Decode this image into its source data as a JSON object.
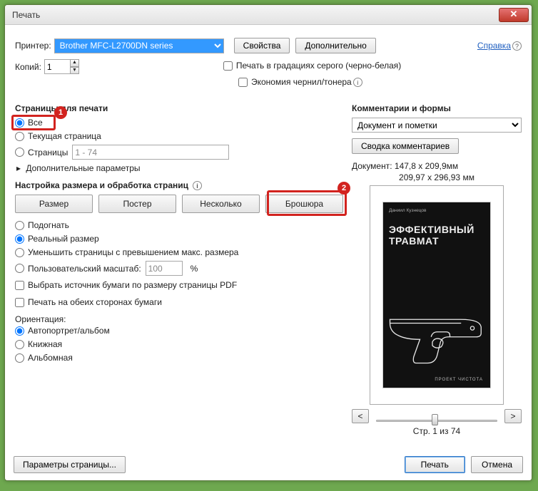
{
  "window_title": "Печать",
  "help_label": "Справка",
  "printer": {
    "label": "Принтер:",
    "selected": "Brother MFC-L2700DN series",
    "properties_btn": "Свойства",
    "advanced_btn": "Дополнительно"
  },
  "copies": {
    "label": "Копий:",
    "value": "1"
  },
  "grayscale": {
    "label": "Печать в градациях серого (черно-белая)",
    "checked": false
  },
  "economy": {
    "label": "Экономия чернил/тонера",
    "checked": false
  },
  "pages": {
    "section": "Страницы для печати",
    "all": "Все",
    "current": "Текущая страница",
    "range_label": "Страницы",
    "range_value": "1 - 74",
    "more": "Дополнительные параметры"
  },
  "sizing": {
    "section": "Настройка размера и обработка страниц",
    "size_btn": "Размер",
    "poster_btn": "Постер",
    "multiple_btn": "Несколько",
    "booklet_btn": "Брошюра",
    "fit": "Подогнать",
    "real": "Реальный размер",
    "shrink": "Уменьшить страницы с превышением макс. размера",
    "custom_label": "Пользовательский масштаб:",
    "custom_value": "100",
    "percent": "%",
    "paper_source": "Выбрать источник бумаги по размеру страницы PDF",
    "duplex": "Печать на обеих сторонах бумаги"
  },
  "orientation": {
    "section": "Ориентация:",
    "auto": "Автопортрет/альбом",
    "portrait": "Книжная",
    "landscape": "Альбомная"
  },
  "comments": {
    "section": "Комментарии и формы",
    "selected": "Документ и пометки",
    "summary_btn": "Сводка комментариев"
  },
  "preview": {
    "doc_size": "Документ: 147,8 x 209,9мм",
    "paper_size": "209,97 x 296,93 мм",
    "author": "Даниил Кузнецов",
    "title1": "ЭФФЕКТИВНЫЙ",
    "title2": "ТРАВМАТ",
    "footer": "ПРОЕКТ ЧИСТОТА",
    "page_indicator": "Стр. 1 из 74",
    "prev": "<",
    "next": ">"
  },
  "footer": {
    "page_setup": "Параметры страницы...",
    "print": "Печать",
    "cancel": "Отмена"
  },
  "callouts": {
    "c1": "1",
    "c2": "2"
  }
}
